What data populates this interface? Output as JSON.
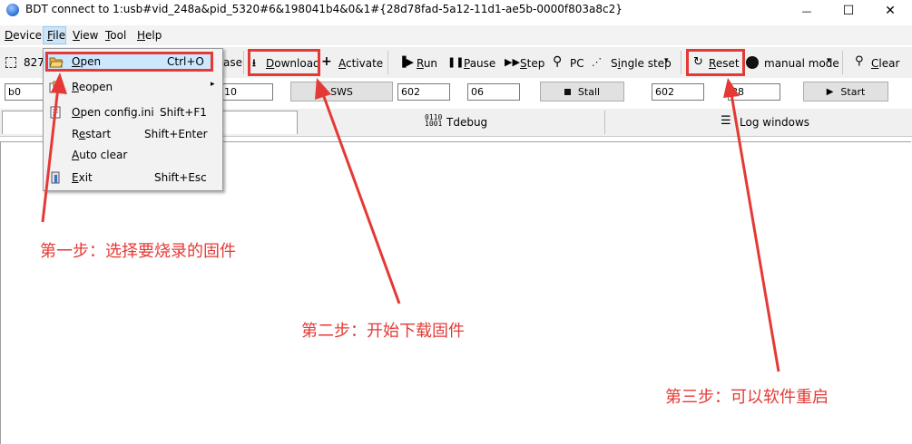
{
  "window": {
    "title": "BDT connect to 1:usb#vid_248a&pid_5320#6&198041b4&0&1#{28d78fad-5a12-11d1-ae5b-0000f803a8c2}",
    "minimize_glyph": "—",
    "maximize_glyph": "☐",
    "close_glyph": "✕"
  },
  "menubar": {
    "items": [
      {
        "label": "Device",
        "mnemonic": "D"
      },
      {
        "label": "File",
        "mnemonic": "F"
      },
      {
        "label": "View",
        "mnemonic": "V"
      },
      {
        "label": "Tool",
        "mnemonic": "T"
      },
      {
        "label": "Help",
        "mnemonic": "H"
      }
    ]
  },
  "file_menu": {
    "items": [
      {
        "label": "Open",
        "shortcut": "Ctrl+O",
        "icon": "folder-open-icon",
        "highlighted": true
      },
      {
        "label": "Reopen",
        "shortcut": "",
        "icon": "recent-files-icon",
        "submenu": true
      },
      {
        "label": "Open config.ini",
        "shortcut": "Shift+F1",
        "icon": "config-file-icon"
      },
      {
        "label": "Restart",
        "shortcut": "Shift+Enter",
        "icon": ""
      },
      {
        "label": "Auto clear",
        "shortcut": "",
        "icon": ""
      },
      {
        "label": "Exit",
        "shortcut": "Shift+Esc",
        "icon": "exit-icon"
      }
    ],
    "submenu_arrow": "▸"
  },
  "toolbar": {
    "chip_label": "827",
    "erase_label": "ase",
    "download_label": "Download",
    "activate_label": "Activate",
    "run_label": "Run",
    "pause_label": "Pause",
    "step_label": "Step",
    "pc_label": "PC",
    "single_step_label": "Single step",
    "reset_label": "Reset",
    "manual_mode_label": "manual mode",
    "clear_label": "Clear",
    "dropdown_arrow": "▾"
  },
  "inputs": {
    "addr1": "b0",
    "addr2": "10",
    "sws_label": "SWS",
    "reg_addr": "602",
    "reg_val": "06",
    "stall_label": "Stall",
    "start_addr": "602",
    "start_val": "88",
    "start_label": "Start"
  },
  "tabs": {
    "tdebug_label": "Tdebug",
    "log_label": "Log windows"
  },
  "annotations": {
    "step1": "第一步：选择要烧录的固件",
    "step2": "第二步：开始下载固件",
    "step3": "第三步：可以软件重启",
    "color": "#e53935"
  }
}
